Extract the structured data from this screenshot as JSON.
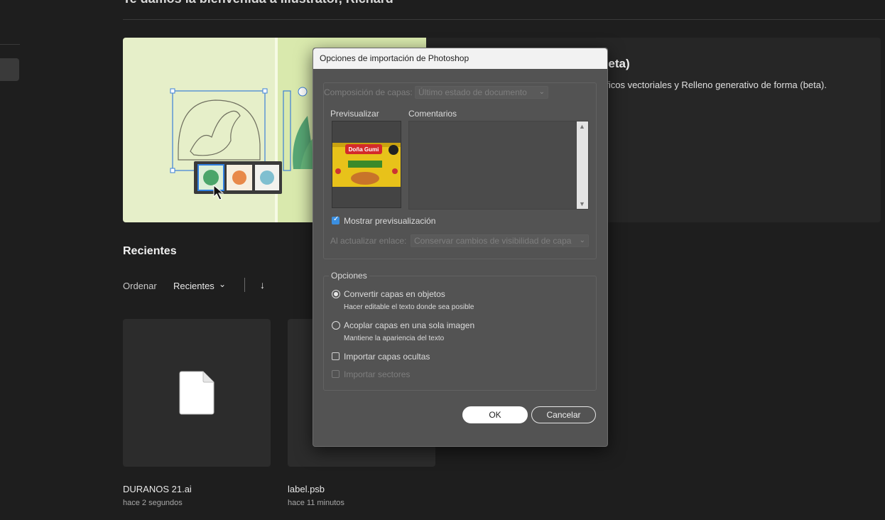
{
  "home": {
    "welcome": "Te damos la bienvenida a Illustrator, Richard",
    "banner_title": "beta)",
    "banner_desc": "áficos vectoriales y Relleno generativo de forma (beta).",
    "recents_title": "Recientes",
    "sort_label": "Ordenar",
    "sort_value": "Recientes",
    "files": [
      {
        "name": "DURANOS 21.ai",
        "time": "hace 2 segundos"
      },
      {
        "name": "label.psb",
        "time": "hace 11 minutos"
      }
    ]
  },
  "dialog": {
    "title": "Opciones de importación de Photoshop",
    "layer_comp_label": "Composición de capas:",
    "layer_comp_value": "Último estado de documento",
    "preview_label": "Previsualizar",
    "comments_label": "Comentarios",
    "show_preview_label": "Mostrar previsualización",
    "show_preview_checked": true,
    "update_link_label": "Al actualizar enlace:",
    "update_link_value": "Conservar cambios de visibilidad de capa",
    "options_label": "Opciones",
    "convert_label": "Convertir capas en objetos",
    "convert_hint": "Hacer editable el texto donde sea posible",
    "flatten_label": "Acoplar capas en una sola imagen",
    "flatten_hint": "Mantiene la apariencia del texto",
    "hidden_label": "Importar capas ocultas",
    "slices_label": "Importar sectores",
    "selected_option": "convert",
    "ok_label": "OK",
    "cancel_label": "Cancelar",
    "preview_brand": "Doña Gumi"
  },
  "colors": {
    "accent": "#3b8fe0",
    "dialog_bg": "#535353",
    "app_bg": "#1e1e1e"
  }
}
